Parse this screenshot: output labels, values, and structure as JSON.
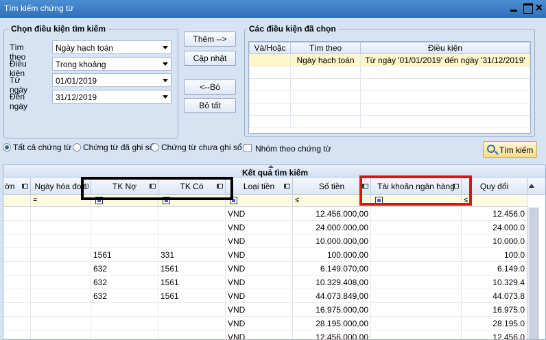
{
  "window": {
    "title": "Tìm kiếm chứng từ",
    "close_glyph": "✕"
  },
  "left_group": {
    "title": "Chọn điều kiện tìm kiếm",
    "fields": [
      {
        "label": "Tìm theo",
        "value": "Ngày hạch toán"
      },
      {
        "label": "Điều kiện",
        "value": "Trong khoảng"
      },
      {
        "label": "Từ ngày",
        "value": "01/01/2019"
      },
      {
        "label": "Đến ngày",
        "value": "31/12/2019"
      }
    ]
  },
  "buttons": {
    "add": "Thêm -->",
    "update": "Cập nhật",
    "remove": "<--Bỏ",
    "remove_all": "Bỏ tất"
  },
  "right_group": {
    "title": "Các điều kiện đã chọn",
    "headers": [
      "Và/Hoặc",
      "Tìm theo",
      "Điều kiện"
    ],
    "rows": [
      [
        "",
        "Ngày hạch toán",
        "Từ ngày '01/01/2019' đến ngày '31/12/2019'"
      ]
    ]
  },
  "options": {
    "radios": [
      "Tất cả chứng từ",
      "Chứng từ đã ghi sổ",
      "Chứng từ chưa ghi sổ"
    ],
    "selected": 0,
    "group_by_voucher": "Nhóm theo chứng từ",
    "search_button": "Tìm kiếm"
  },
  "results": {
    "title": "Kết quả tìm kiếm",
    "columns": [
      "ờn",
      "Ngày hóa đơn",
      "TK Nợ",
      "TK Có",
      "Loại tiền",
      "Số tiền",
      "Tài khoản ngân hàng",
      "Quy đổi"
    ],
    "filter_ops": [
      "",
      "=",
      "",
      "",
      "",
      "≤",
      "",
      "≤"
    ],
    "rows": [
      [
        "",
        "",
        "",
        "",
        "VND",
        "12.456.000,00",
        "",
        "12.456.0"
      ],
      [
        "",
        "",
        "",
        "",
        "VND",
        "24.000.000,00",
        "",
        "24.000.0"
      ],
      [
        "",
        "",
        "",
        "",
        "VND",
        "10.000.000,00",
        "",
        "10.000.0"
      ],
      [
        "",
        "",
        "1561",
        "331",
        "VND",
        "100.000,00",
        "",
        "100.0"
      ],
      [
        "",
        "",
        "632",
        "1561",
        "VND",
        "6.149.070,00",
        "",
        "6.149.0"
      ],
      [
        "",
        "",
        "632",
        "1561",
        "VND",
        "10.329.408,00",
        "",
        "10.329.4"
      ],
      [
        "",
        "",
        "632",
        "1561",
        "VND",
        "44.073.849,00",
        "",
        "44.073.8"
      ],
      [
        "",
        "",
        "",
        "",
        "VND",
        "16.975.000,00",
        "",
        "16.975.0"
      ],
      [
        "",
        "",
        "",
        "",
        "VND",
        "28.195.000,00",
        "",
        "28.195.0"
      ],
      [
        "",
        "",
        "",
        "",
        "VND",
        "12.456.000,00",
        "",
        "12.456.0"
      ]
    ]
  }
}
